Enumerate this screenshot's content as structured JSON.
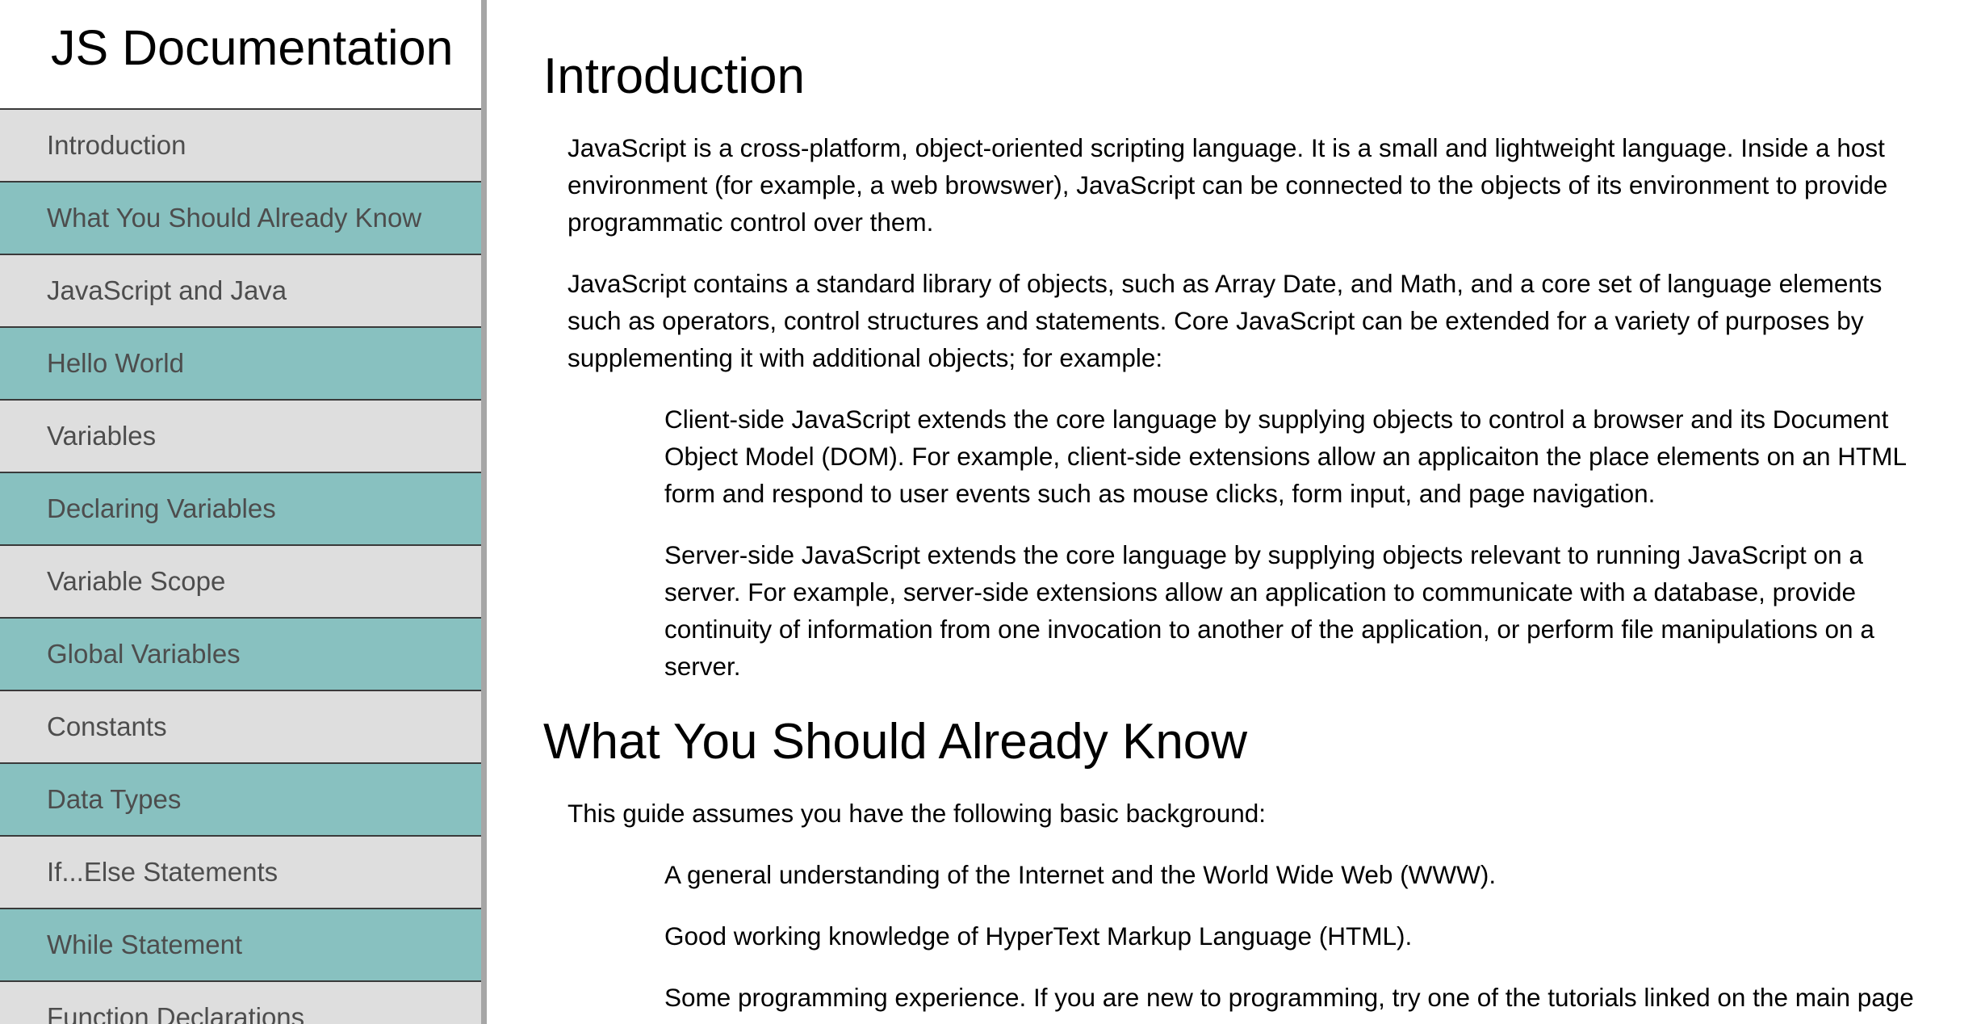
{
  "navbar": {
    "title": "JS Documentation",
    "items": [
      {
        "label": "Introduction"
      },
      {
        "label": "What You Should Already Know"
      },
      {
        "label": "JavaScript and Java"
      },
      {
        "label": "Hello World"
      },
      {
        "label": "Variables"
      },
      {
        "label": "Declaring Variables"
      },
      {
        "label": "Variable Scope"
      },
      {
        "label": "Global Variables"
      },
      {
        "label": "Constants"
      },
      {
        "label": "Data Types"
      },
      {
        "label": "If...Else Statements"
      },
      {
        "label": "While Statement"
      },
      {
        "label": "Function Declarations"
      }
    ]
  },
  "main": {
    "sections": [
      {
        "heading": "Introduction",
        "paragraphs": [
          "JavaScript is a cross-platform, object-oriented scripting language. It is a small and lightweight language. Inside a host environment (for example, a web browswer), JavaScript can be connected to the objects of its environment to provide programmatic control over them.",
          "JavaScript contains a standard library of objects, such as Array Date, and Math, and a core set of language elements such as operators, control structures and statements. Core JavaScript can be extended for a variety of purposes by supplementing it with additional objects; for example:"
        ],
        "items": [
          "Client-side JavaScript extends the core language by supplying objects to control a browser and its Document Object Model (DOM). For example, client-side extensions allow an applicaiton the place elements on an HTML form and respond to user events such as mouse clicks, form input, and page navigation.",
          "Server-side JavaScript extends the core language by supplying objects relevant to running JavaScript on a server. For example, server-side extensions allow an application to communicate with a database, provide continuity of information from one invocation to another of the application, or perform file manipulations on a server."
        ]
      },
      {
        "heading": "What You Should Already Know",
        "paragraphs": [
          "This guide assumes you have the following basic background:"
        ],
        "items": [
          "A general understanding of the Internet and the World Wide Web (WWW).",
          "Good working knowledge of HyperText Markup Language (HTML).",
          "Some programming experience. If you are new to programming, try one of the tutorials linked on the main page about JavaScript."
        ]
      }
    ]
  },
  "colors": {
    "nav_item_light": "#dedede",
    "nav_item_teal": "#88c1c0",
    "nav_border": "#a6a6a6",
    "nav_text": "#4d4d4d"
  }
}
